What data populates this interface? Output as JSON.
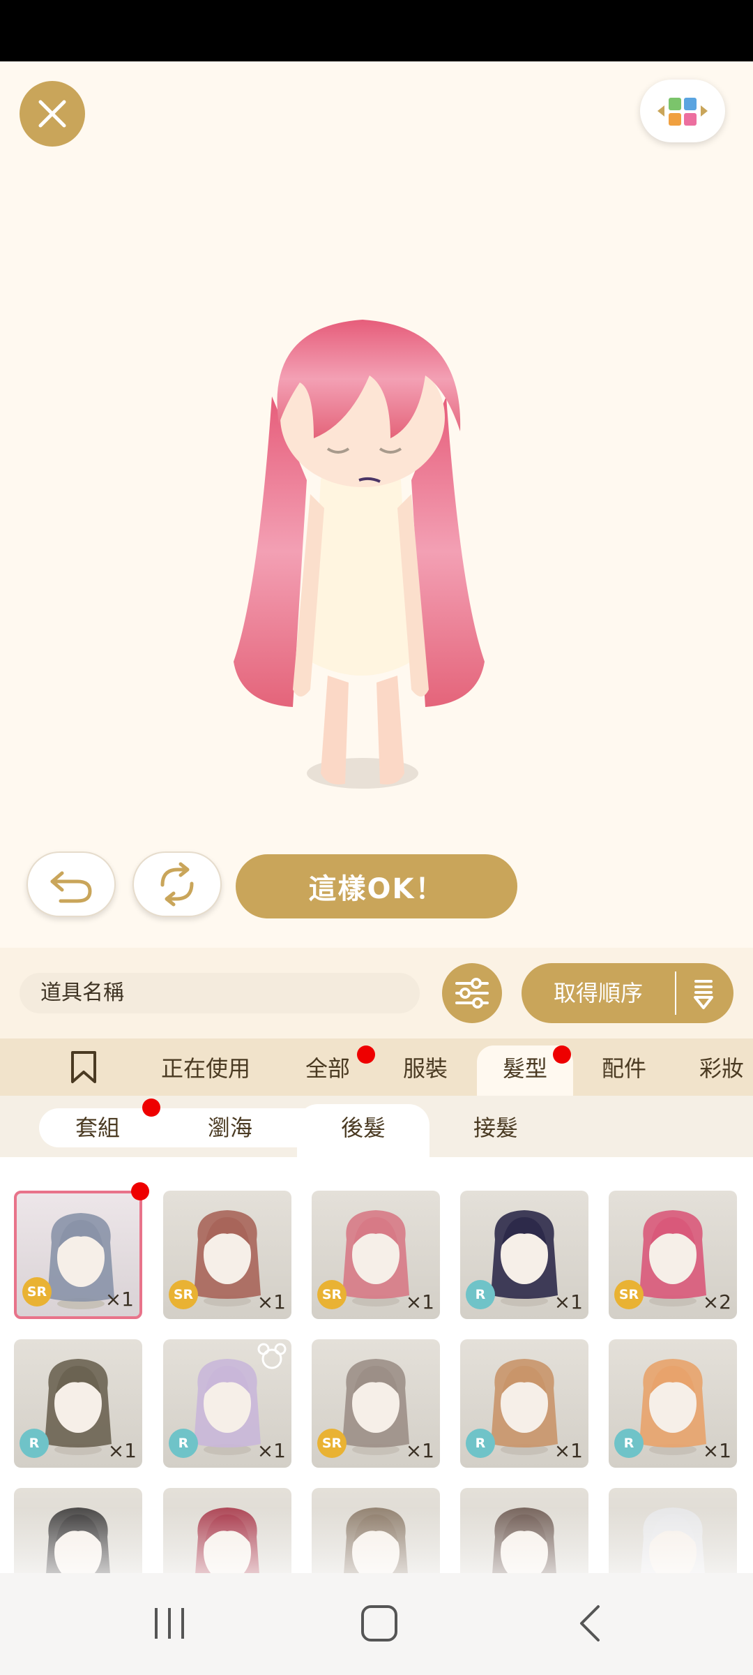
{
  "header": {
    "close_icon": "close-icon",
    "layout_icon": "layout-grid-icon"
  },
  "actions": {
    "undo_icon": "undo-icon",
    "refresh_icon": "refresh-icon",
    "ok_label": "這樣OK！"
  },
  "search": {
    "placeholder": "道具名稱",
    "filter_icon": "sliders-icon",
    "sort_label": "取得順序",
    "sort_icon": "sort-icon"
  },
  "categories": [
    {
      "icon": "bookmark-icon"
    },
    {
      "label": "正在使用"
    },
    {
      "label": "全部",
      "badge": true
    },
    {
      "label": "服裝"
    },
    {
      "label": "髮型",
      "badge": true,
      "active": true
    },
    {
      "label": "配件"
    },
    {
      "label": "彩妝"
    }
  ],
  "subtabs": [
    {
      "label": "套組",
      "badge": true
    },
    {
      "label": "瀏海"
    },
    {
      "label": "後髮",
      "active": true
    },
    {
      "label": "接髮"
    }
  ],
  "items": [
    {
      "rarity": "SR",
      "count": "×1",
      "selected": true,
      "badge": true,
      "hair": "#8a93a8"
    },
    {
      "rarity": "SR",
      "count": "×1",
      "hair": "#a8655a"
    },
    {
      "rarity": "SR",
      "count": "×1",
      "hair": "#d77a86"
    },
    {
      "rarity": "R",
      "count": "×1",
      "hair": "#2d2a4a"
    },
    {
      "rarity": "SR",
      "count": "×2",
      "hair": "#d9597a"
    },
    {
      "rarity": "R",
      "count": "×1",
      "hair": "#6b6352"
    },
    {
      "rarity": "R",
      "count": "×1",
      "hair": "#c9b7d9",
      "bear_icon": true
    },
    {
      "rarity": "SR",
      "count": "×1",
      "hair": "#9c8f87"
    },
    {
      "rarity": "R",
      "count": "×1",
      "hair": "#c9956a"
    },
    {
      "rarity": "R",
      "count": "×1",
      "hair": "#e8a36c"
    },
    {
      "hair": "#3c3a3a"
    },
    {
      "hair": "#a8384a"
    },
    {
      "hair": "#8c7a68"
    },
    {
      "hair": "#6e5a52"
    },
    {
      "hair": "#e8e8ea"
    }
  ],
  "navbar": {
    "recent_icon": "recent-apps-icon",
    "home_icon": "home-icon",
    "back_icon": "back-icon"
  },
  "colors": {
    "accent": "#c9a55a",
    "badge_red": "#ee0000",
    "selected_border": "#e8738a"
  }
}
